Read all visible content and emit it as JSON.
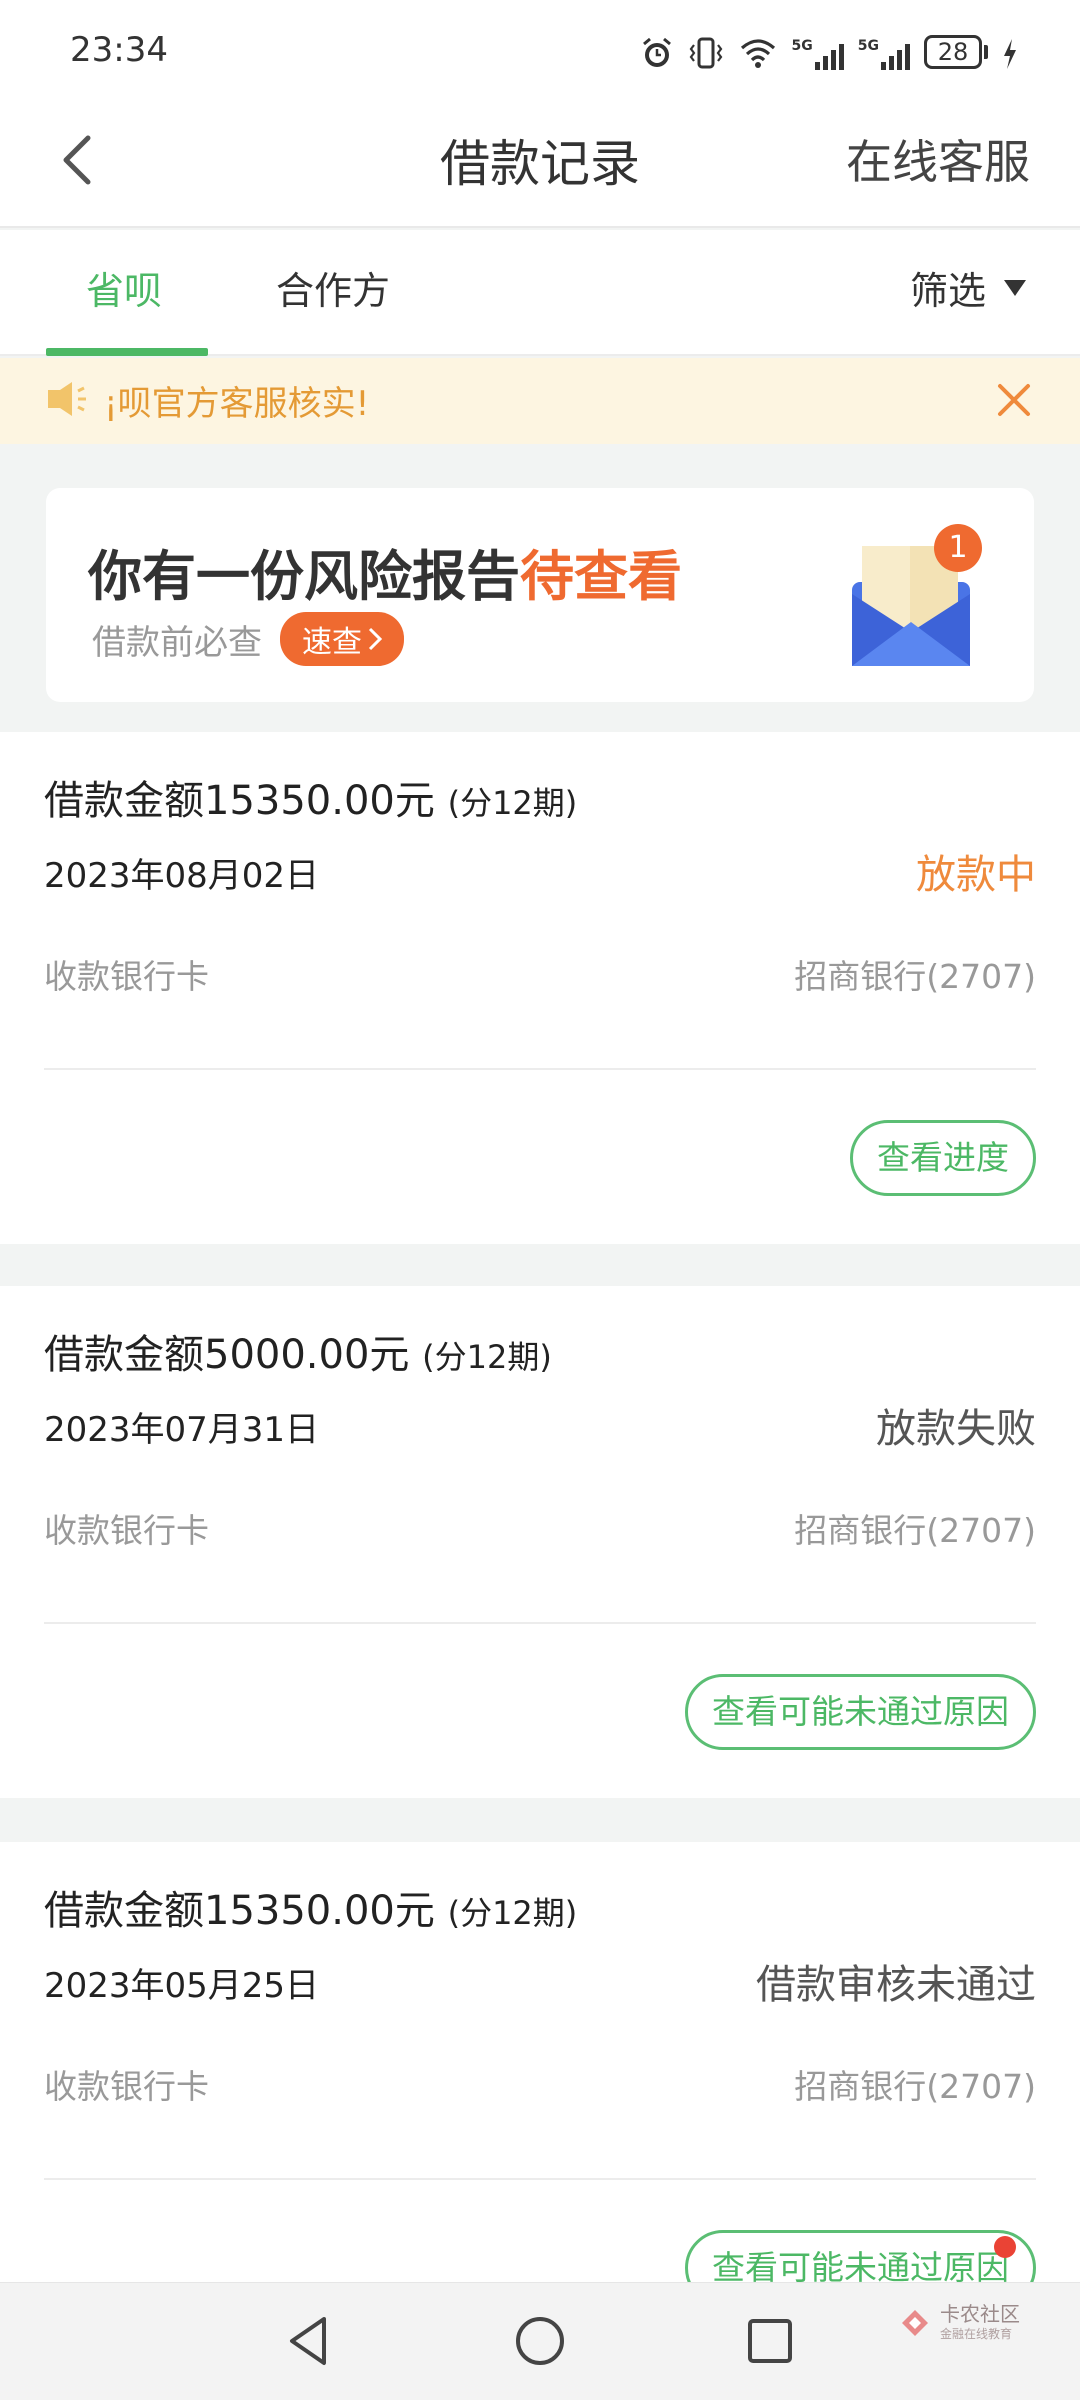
{
  "status_bar": {
    "time": "23:34",
    "battery": "28",
    "network_labels": [
      "5G",
      "5G"
    ],
    "icons": [
      "alarm-icon",
      "vibrate-icon",
      "wifi-icon",
      "signal-icon",
      "signal-icon",
      "battery-icon",
      "charging-icon"
    ]
  },
  "header": {
    "title": "借款记录",
    "service_label": "在线客服",
    "back_icon": "chevron-left-icon"
  },
  "tabs": {
    "items": [
      {
        "label": "省呗",
        "active": true
      },
      {
        "label": "合作方",
        "active": false
      }
    ],
    "filter_label": "筛选"
  },
  "notice": {
    "text": "¡呗官方客服核实!",
    "icon": "speaker-icon",
    "close_icon": "close-icon"
  },
  "banner": {
    "headline_prefix": "你有一份风险报告",
    "headline_highlight": "待查看",
    "sub_text": "借款前必查",
    "button_label": "速查",
    "badge_count": "1",
    "colors": {
      "highlight": "#ef6a30",
      "envelope": "#4a74e6"
    }
  },
  "records": [
    {
      "amount": "借款金额15350.00元",
      "periods": "(分12期)",
      "date": "2023年08月02日",
      "status": "放款中",
      "status_color": "#ef8a3c",
      "card_label": "收款银行卡",
      "bank": "招商银行(2707)",
      "action": "查看进度"
    },
    {
      "amount": "借款金额5000.00元",
      "periods": "(分12期)",
      "date": "2023年07月31日",
      "status": "放款失败",
      "status_color": "#555555",
      "card_label": "收款银行卡",
      "bank": "招商银行(2707)",
      "action": "查看可能未通过原因"
    },
    {
      "amount": "借款金额15350.00元",
      "periods": "(分12期)",
      "date": "2023年05月25日",
      "status": "借款审核未通过",
      "status_color": "#555555",
      "card_label": "收款银行卡",
      "bank": "招商银行(2707)",
      "action": "查看可能未通过原因"
    }
  ],
  "watermark": {
    "title": "卡农社区",
    "subtitle": "金融在线教育"
  },
  "theme": {
    "accent": "#4cb865",
    "background": "#f2f4f3"
  }
}
